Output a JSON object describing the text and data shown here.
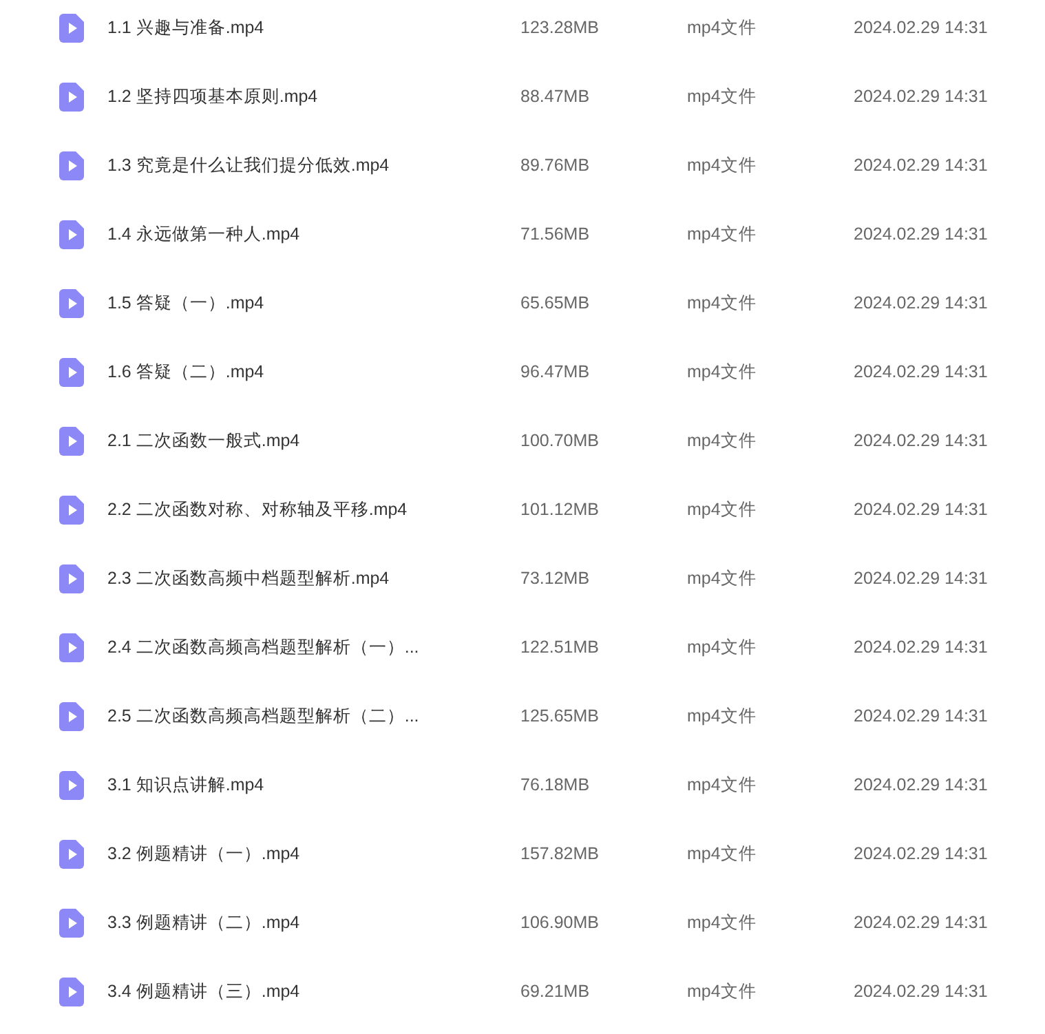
{
  "files": [
    {
      "name": "1.1 兴趣与准备.mp4",
      "size": "123.28MB",
      "type": "mp4文件",
      "date": "2024.02.29 14:31"
    },
    {
      "name": "1.2 坚持四项基本原则.mp4",
      "size": "88.47MB",
      "type": "mp4文件",
      "date": "2024.02.29 14:31"
    },
    {
      "name": "1.3 究竟是什么让我们提分低效.mp4",
      "size": "89.76MB",
      "type": "mp4文件",
      "date": "2024.02.29 14:31"
    },
    {
      "name": "1.4 永远做第一种人.mp4",
      "size": "71.56MB",
      "type": "mp4文件",
      "date": "2024.02.29 14:31"
    },
    {
      "name": "1.5 答疑（一）.mp4",
      "size": "65.65MB",
      "type": "mp4文件",
      "date": "2024.02.29 14:31"
    },
    {
      "name": "1.6 答疑（二）.mp4",
      "size": "96.47MB",
      "type": "mp4文件",
      "date": "2024.02.29 14:31"
    },
    {
      "name": "2.1 二次函数一般式.mp4",
      "size": "100.70MB",
      "type": "mp4文件",
      "date": "2024.02.29 14:31"
    },
    {
      "name": "2.2 二次函数对称、对称轴及平移.mp4",
      "size": "101.12MB",
      "type": "mp4文件",
      "date": "2024.02.29 14:31"
    },
    {
      "name": "2.3 二次函数高频中档题型解析.mp4",
      "size": "73.12MB",
      "type": "mp4文件",
      "date": "2024.02.29 14:31"
    },
    {
      "name": "2.4 二次函数高频高档题型解析（一）...",
      "size": "122.51MB",
      "type": "mp4文件",
      "date": "2024.02.29 14:31"
    },
    {
      "name": "2.5 二次函数高频高档题型解析（二）...",
      "size": "125.65MB",
      "type": "mp4文件",
      "date": "2024.02.29 14:31"
    },
    {
      "name": "3.1 知识点讲解.mp4",
      "size": "76.18MB",
      "type": "mp4文件",
      "date": "2024.02.29 14:31"
    },
    {
      "name": "3.2 例题精讲（一）.mp4",
      "size": "157.82MB",
      "type": "mp4文件",
      "date": "2024.02.29 14:31"
    },
    {
      "name": "3.3 例题精讲（二）.mp4",
      "size": "106.90MB",
      "type": "mp4文件",
      "date": "2024.02.29 14:31"
    },
    {
      "name": "3.4 例题精讲（三）.mp4",
      "size": "69.21MB",
      "type": "mp4文件",
      "date": "2024.02.29 14:31"
    }
  ]
}
